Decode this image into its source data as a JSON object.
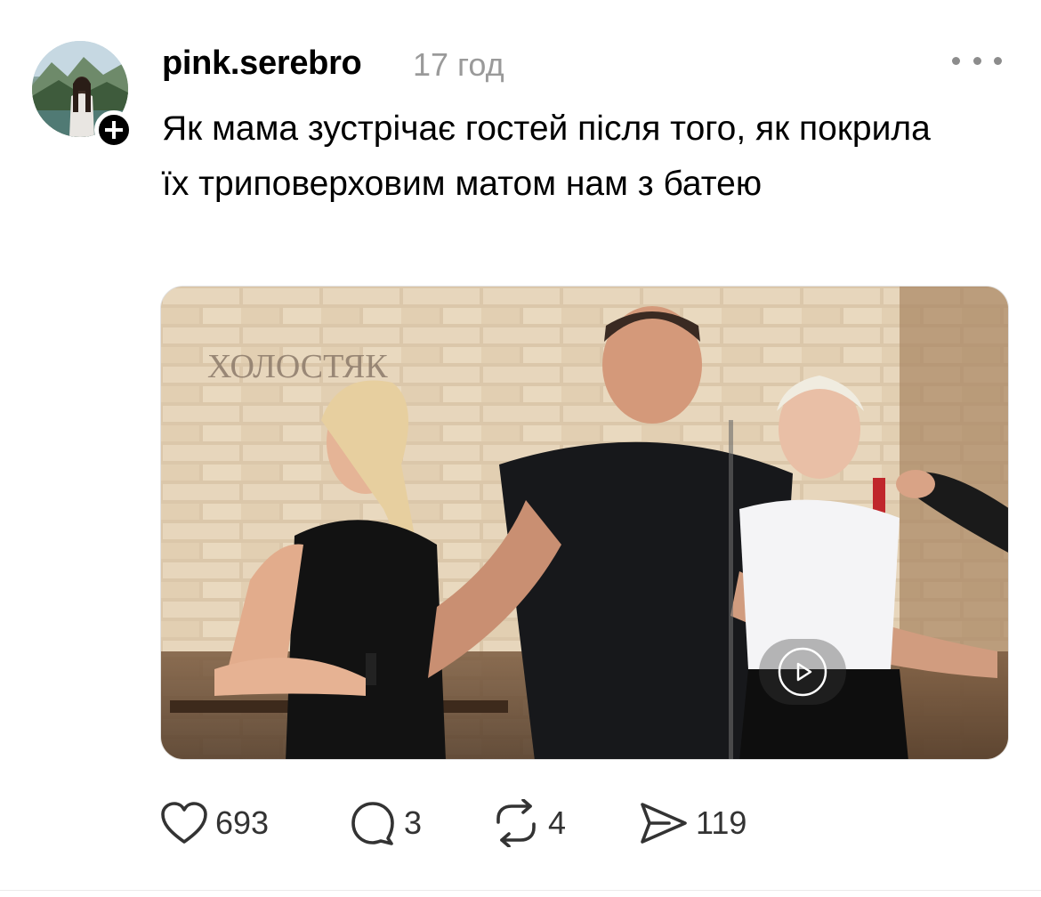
{
  "post": {
    "username": "pink.serebro",
    "time": "17 год",
    "caption": "Як мама зустрічає гостей після того, як покрила їх триповерховим матом нам з батею",
    "media": {
      "watermark": "ХОЛОСТЯК"
    },
    "actions": {
      "likes": "693",
      "comments": "3",
      "reposts": "4",
      "shares": "119"
    }
  },
  "colors": {
    "text": "#000000",
    "muted": "#9a9a9a",
    "icon": "#333333"
  },
  "icons": [
    "avatar",
    "follow-plus-icon",
    "more-icon",
    "play-icon",
    "heart-icon",
    "comment-icon",
    "repost-icon",
    "share-icon"
  ]
}
